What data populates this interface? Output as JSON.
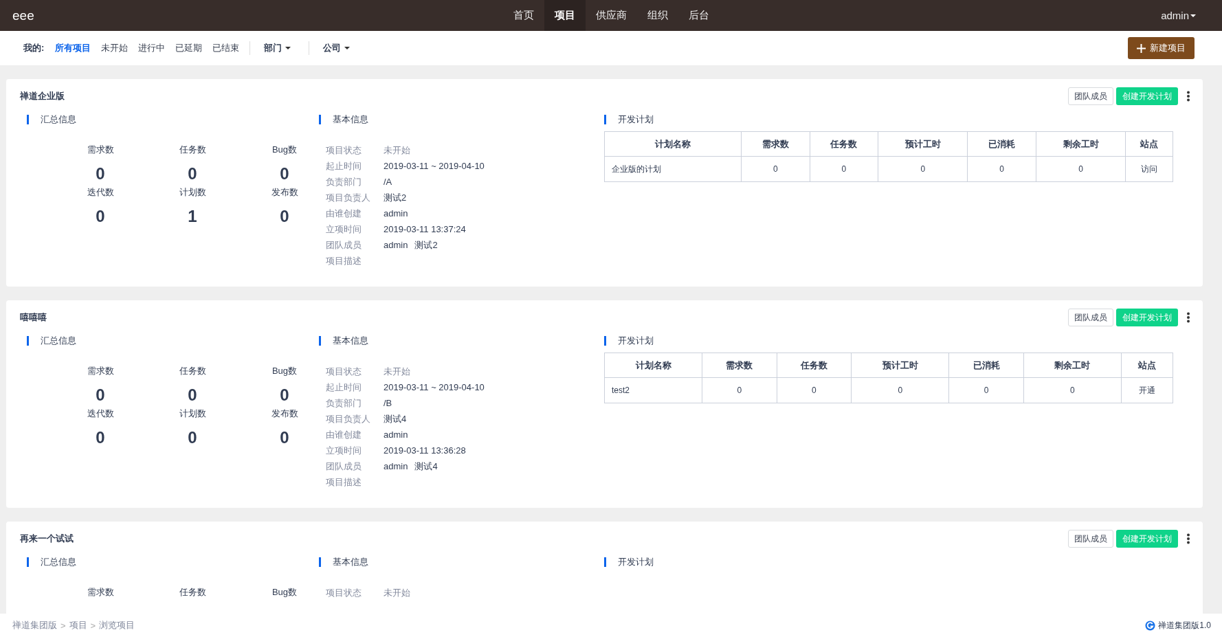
{
  "topbar": {
    "brand": "eee",
    "nav": [
      {
        "label": "首页",
        "selected": false
      },
      {
        "label": "项目",
        "selected": true
      },
      {
        "label": "供应商",
        "selected": false
      },
      {
        "label": "组织",
        "selected": false
      },
      {
        "label": "后台",
        "selected": false
      }
    ],
    "user": "admin"
  },
  "filters": {
    "label": "我的:",
    "items": [
      {
        "label": "所有项目",
        "selected": true
      },
      {
        "label": "未开始",
        "selected": false
      },
      {
        "label": "进行中",
        "selected": false
      },
      {
        "label": "已延期",
        "selected": false
      },
      {
        "label": "已结束",
        "selected": false
      }
    ],
    "dropdowns": [
      "部门",
      "公司"
    ],
    "new_button": "新建项目"
  },
  "projects": [
    {
      "name": "禅道企业版",
      "team_button": "团队成员",
      "create_button": "创建开发计划",
      "summary": {
        "title": "汇总信息",
        "stats": [
          {
            "label": "需求数",
            "value": "0"
          },
          {
            "label": "任务数",
            "value": "0"
          },
          {
            "label": "Bug数",
            "value": "0"
          },
          {
            "label": "迭代数",
            "value": "0"
          },
          {
            "label": "计划数",
            "value": "1"
          },
          {
            "label": "发布数",
            "value": "0"
          }
        ]
      },
      "basic": {
        "title": "基本信息",
        "rows": [
          {
            "label": "项目状态",
            "values": [
              "未开始"
            ],
            "kind": "status"
          },
          {
            "label": "起止时间",
            "values": [
              "2019-03-11 ~ 2019-04-10"
            ]
          },
          {
            "label": "负责部门",
            "values": [
              "/A"
            ]
          },
          {
            "label": "项目负责人",
            "values": [
              "测试2"
            ]
          },
          {
            "label": "由谁创建",
            "values": [
              "admin"
            ]
          },
          {
            "label": "立项时间",
            "values": [
              "2019-03-11 13:37:24"
            ]
          },
          {
            "label": "团队成员",
            "values": [
              "admin",
              "测试2"
            ]
          },
          {
            "label": "项目描述"
          }
        ]
      },
      "plan": {
        "title": "开发计划",
        "columns": [
          "计划名称",
          "需求数",
          "任务数",
          "预计工时",
          "已消耗",
          "剩余工时",
          "站点"
        ],
        "rows": [
          [
            "企业版的计划",
            "0",
            "0",
            "0",
            "0",
            "0",
            "访问"
          ]
        ]
      }
    },
    {
      "name": "嘻嘻嘻",
      "team_button": "团队成员",
      "create_button": "创建开发计划",
      "summary": {
        "title": "汇总信息",
        "stats": [
          {
            "label": "需求数",
            "value": "0"
          },
          {
            "label": "任务数",
            "value": "0"
          },
          {
            "label": "Bug数",
            "value": "0"
          },
          {
            "label": "迭代数",
            "value": "0"
          },
          {
            "label": "计划数",
            "value": "0"
          },
          {
            "label": "发布数",
            "value": "0"
          }
        ]
      },
      "basic": {
        "title": "基本信息",
        "rows": [
          {
            "label": "项目状态",
            "values": [
              "未开始"
            ],
            "kind": "status"
          },
          {
            "label": "起止时间",
            "values": [
              "2019-03-11 ~ 2019-04-10"
            ]
          },
          {
            "label": "负责部门",
            "values": [
              "/B"
            ]
          },
          {
            "label": "项目负责人",
            "values": [
              "测试4"
            ]
          },
          {
            "label": "由谁创建",
            "values": [
              "admin"
            ]
          },
          {
            "label": "立项时间",
            "values": [
              "2019-03-11 13:36:28"
            ]
          },
          {
            "label": "团队成员",
            "values": [
              "admin",
              "测试4"
            ]
          },
          {
            "label": "项目描述"
          }
        ]
      },
      "plan": {
        "title": "开发计划",
        "columns": [
          "计划名称",
          "需求数",
          "任务数",
          "预计工时",
          "已消耗",
          "剩余工时",
          "站点"
        ],
        "rows": [
          [
            "test2",
            "0",
            "0",
            "0",
            "0",
            "0",
            "开通"
          ]
        ]
      }
    },
    {
      "name": "再来一个试试",
      "team_button": "团队成员",
      "create_button": "创建开发计划",
      "summary": {
        "title": "汇总信息",
        "stats": [
          {
            "label": "需求数"
          },
          {
            "label": "任务数"
          },
          {
            "label": "Bug数"
          }
        ]
      },
      "basic": {
        "title": "基本信息",
        "rows": [
          {
            "label": "项目状态",
            "values": [
              "未开始"
            ],
            "kind": "status"
          }
        ]
      },
      "plan": {
        "title": "开发计划"
      }
    }
  ],
  "footer": {
    "breadcrumb": [
      "禅道集团版",
      "项目",
      "浏览项目"
    ],
    "separator": ">",
    "version": "禅道集团版1.0"
  }
}
